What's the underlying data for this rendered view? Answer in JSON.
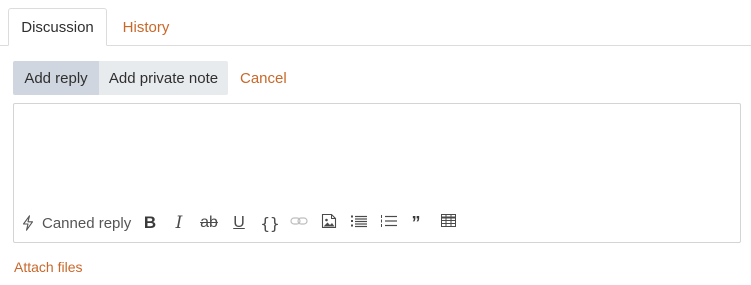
{
  "tabs": [
    {
      "label": "Discussion",
      "active": true
    },
    {
      "label": "History",
      "active": false
    }
  ],
  "reply_modes": {
    "add_reply": "Add reply",
    "add_private_note": "Add private note",
    "selected": "Add reply"
  },
  "cancel_label": "Cancel",
  "editor": {
    "value": "",
    "toolbar": {
      "canned_reply_label": "Canned reply",
      "canned_icon": "lightning-bolt-icon",
      "bold_glyph": "B",
      "italic_glyph": "I",
      "strikethrough_glyph": "ab",
      "underline_glyph": "U",
      "code_glyph": "{}",
      "link_icon": "link-icon",
      "image_icon": "image-icon",
      "bulleted_list_icon": "bulleted-list-icon",
      "numbered_list_icon": "numbered-list-icon",
      "quote_glyph": "”",
      "table_icon": "table-icon"
    }
  },
  "attach_files_label": "Attach files",
  "colors": {
    "accent": "#c8682a",
    "selected_mode_bg": "#cfd6df",
    "mode_bg": "#e8ebee",
    "border": "#d4d4d4"
  }
}
